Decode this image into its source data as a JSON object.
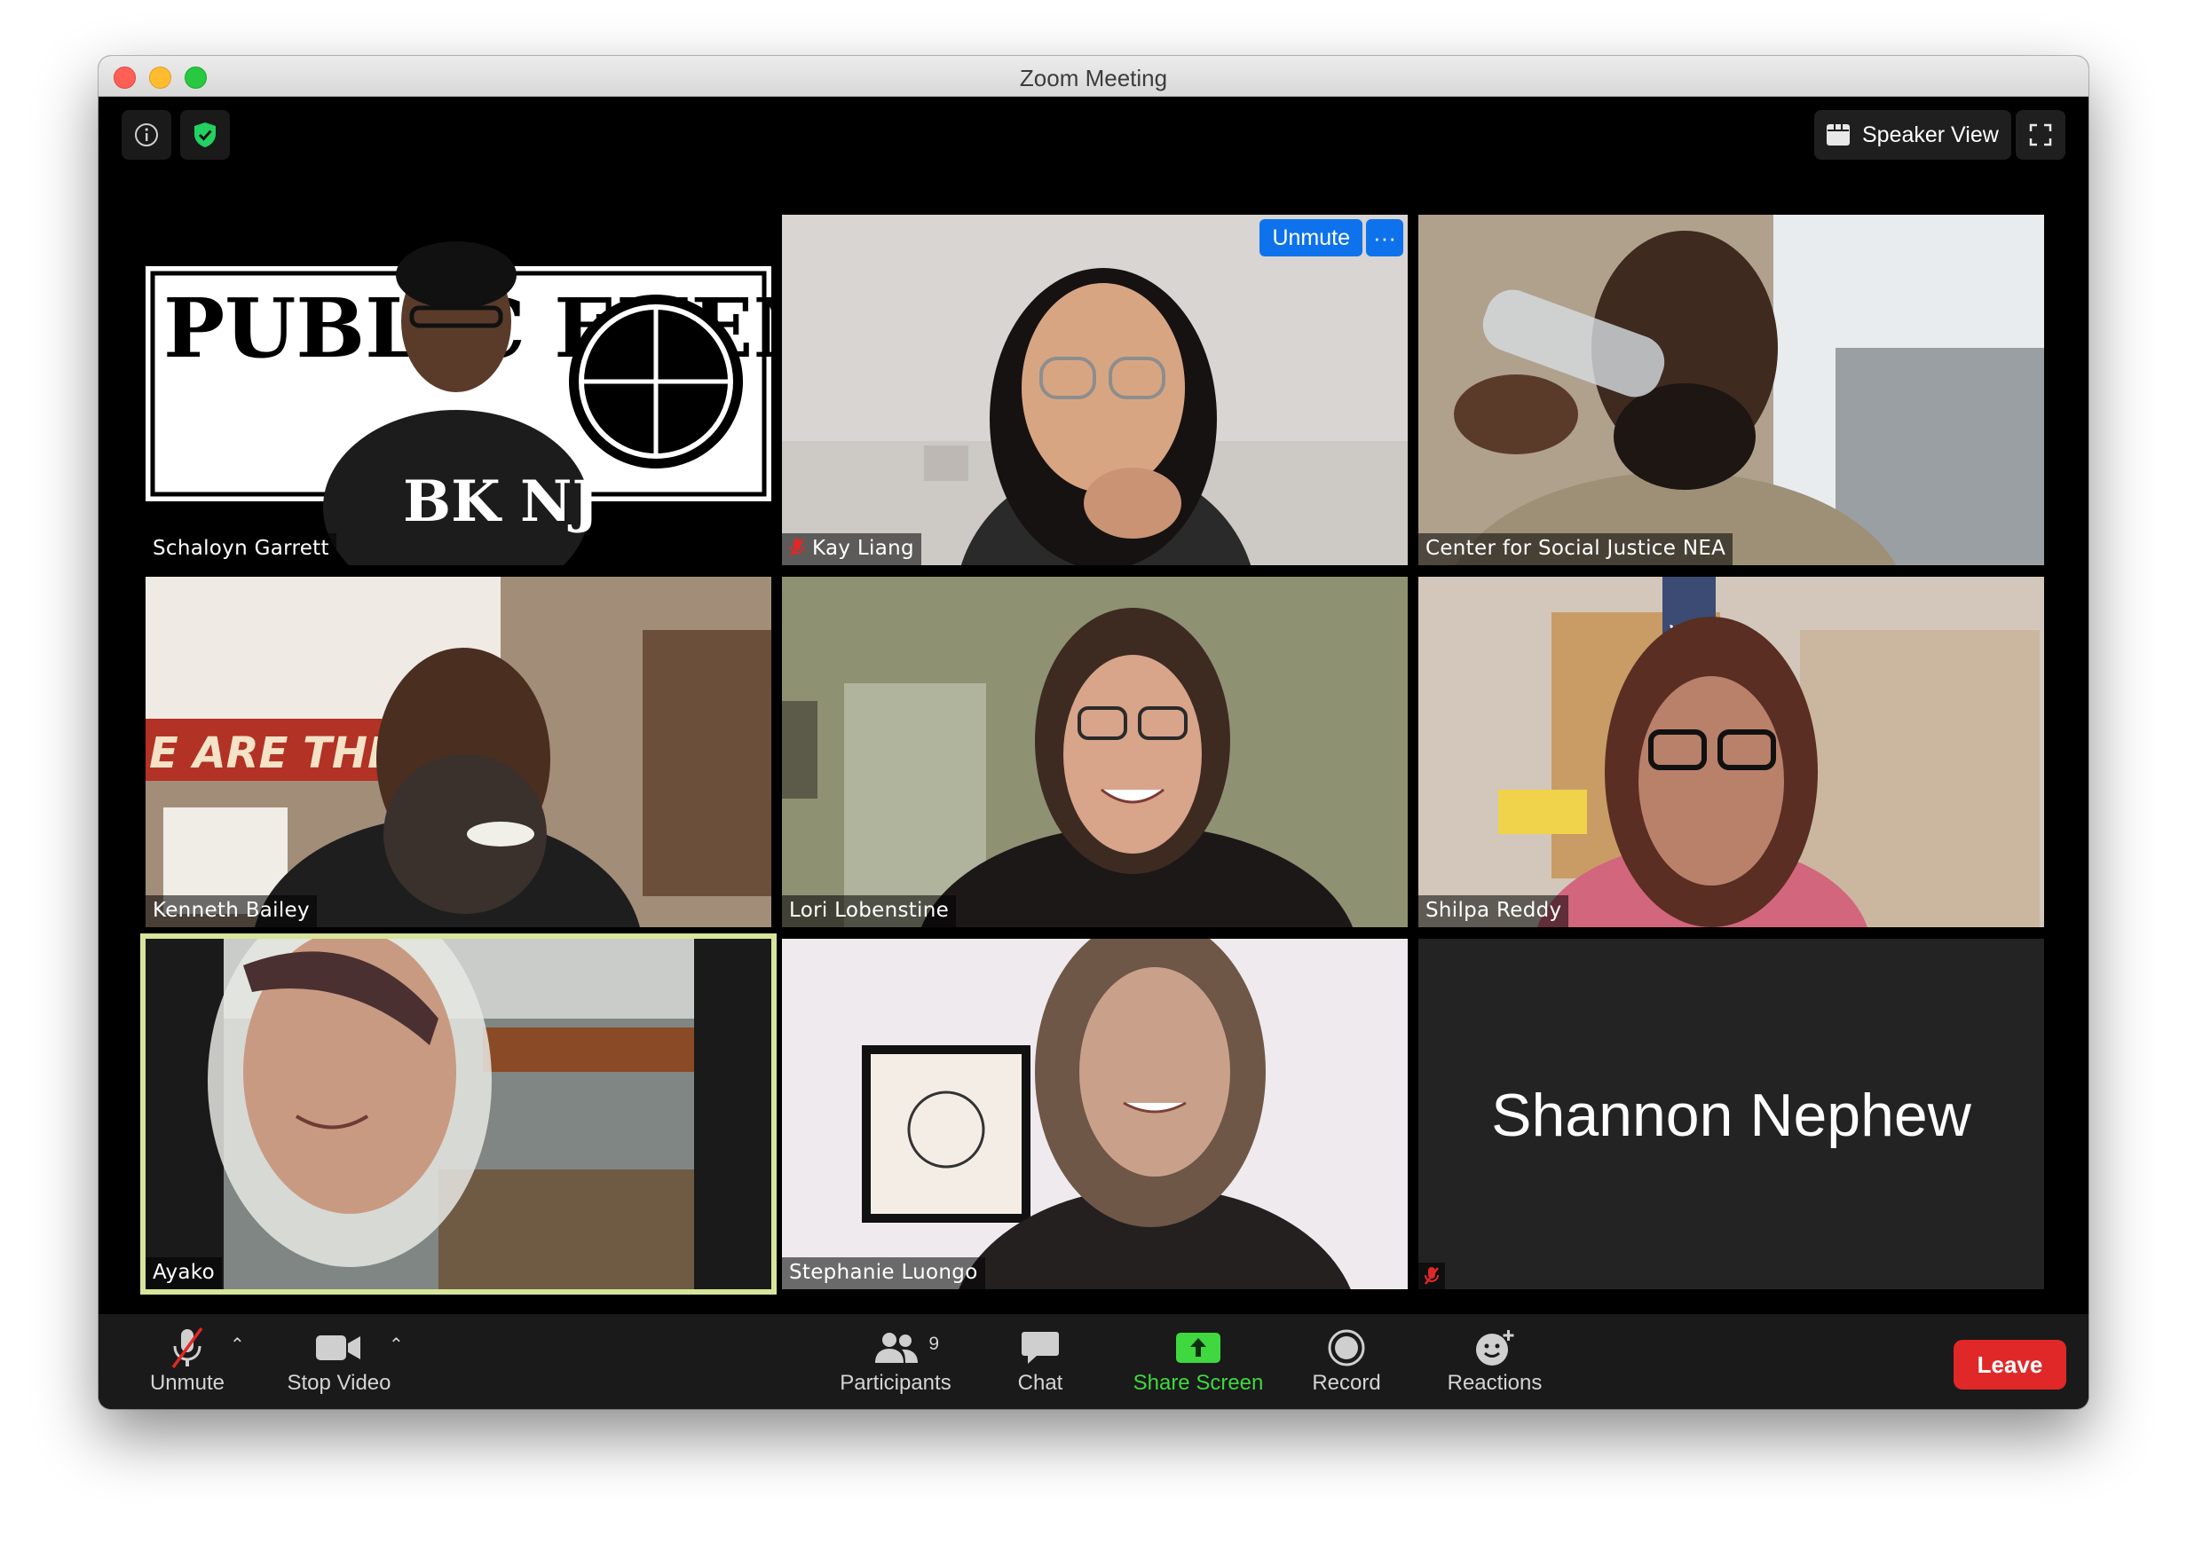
{
  "window": {
    "title": "Zoom Meeting"
  },
  "top_bar": {
    "speaker_view_label": "Speaker View"
  },
  "participants": [
    {
      "name": "Schaloyn Garrett",
      "muted": false
    },
    {
      "name": "Kay Liang",
      "muted": true
    },
    {
      "name": "Center for Social Justice NEA",
      "muted": false
    },
    {
      "name": "Kenneth Bailey",
      "muted": false
    },
    {
      "name": "Lori Lobenstine",
      "muted": false
    },
    {
      "name": "Shilpa Reddy",
      "muted": false
    },
    {
      "name": "Ayako",
      "muted": false,
      "active_speaker": true
    },
    {
      "name": "Stephanie Luongo",
      "muted": false
    },
    {
      "name": "Shannon Nephew",
      "muted": true,
      "video_off": true
    }
  ],
  "tile_overlay": {
    "unmute_label": "Unmute",
    "more_label": "···"
  },
  "backdrop_text": {
    "poster": "PUBLIC ENEMY",
    "shirt": "BK NJ",
    "banner": "E ARE THE PUB",
    "sign": "VOTE"
  },
  "toolbar": {
    "unmute_label": "Unmute",
    "stop_video_label": "Stop Video",
    "participants_label": "Participants",
    "participants_count": "9",
    "chat_label": "Chat",
    "share_screen_label": "Share Screen",
    "record_label": "Record",
    "reactions_label": "Reactions",
    "leave_label": "Leave"
  },
  "colors": {
    "share_green": "#3fd83f",
    "leave_red": "#e02828",
    "unmute_blue": "#0e72ed",
    "active_border": "#d7e59a"
  },
  "icons": [
    "info-icon",
    "shield-check-icon",
    "grid-icon",
    "fullscreen-icon",
    "mic-off-icon",
    "video-camera-icon",
    "participants-icon",
    "chat-icon",
    "share-screen-icon",
    "record-icon",
    "reactions-icon"
  ]
}
